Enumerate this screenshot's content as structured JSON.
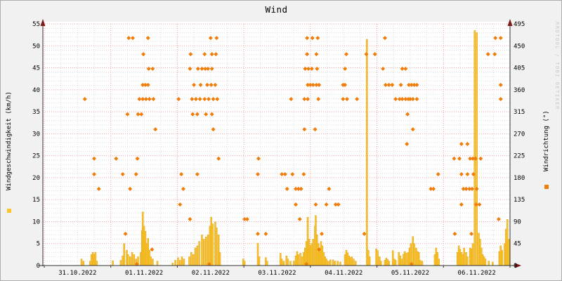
{
  "title": "Wind",
  "watermark": "RRDTOOL / TOBI OETIKER",
  "colors": {
    "background": "#F1F1F1",
    "plot_background": "#FFFFFF",
    "grid_major": "#F2A2A2",
    "grid_minor": "#DCDCDC",
    "axis": "#333333",
    "arrow": "#7F1A1A",
    "bar_fill": "#FBC52D",
    "bar_stroke": "#DE9F12",
    "scatter": "#F07D0A",
    "text": "#000000",
    "watermark_color": "#C9C9C9"
  },
  "axes": {
    "left": {
      "label": "Windgeschwindigkeit (km/h)",
      "min": 0,
      "max": 55,
      "major_step": 5,
      "minor_step": 1,
      "ticks": [
        0,
        5,
        10,
        15,
        20,
        25,
        30,
        35,
        40,
        45,
        50,
        55
      ]
    },
    "right": {
      "label": "Windrichtung (°)",
      "min": 0,
      "max": 495,
      "major_step": 45,
      "ticks": [
        0,
        45,
        90,
        135,
        180,
        225,
        270,
        315,
        360,
        405,
        450,
        495
      ]
    },
    "x": {
      "labels": [
        "31.10.2022",
        "01.11.2022",
        "02.11.2022",
        "03.11.2022",
        "04.11.2022",
        "05.11.2022",
        "06.11.2022"
      ],
      "days_shown": 7,
      "major_grid": "midnight",
      "minor_grid_hours": 6
    }
  },
  "legend": {
    "speed_label": "Windgeschwindigkeit (km/h)",
    "direction_label": "Windrichtung (°)"
  },
  "chart_data": {
    "type": "mixed",
    "title": "Wind",
    "x_unit": "days since 31.10.2022 00:00",
    "x_range": [
      0,
      7
    ],
    "left_ylim": [
      0,
      55
    ],
    "right_ylim": [
      0,
      495
    ],
    "grid": true,
    "series": [
      {
        "name": "Windgeschwindigkeit (km/h)",
        "type": "bar",
        "axis": "left",
        "color": "#FBC52D",
        "points": [
          [
            0.56,
            1.5
          ],
          [
            0.59,
            1
          ],
          [
            0.69,
            1
          ],
          [
            0.71,
            2.5
          ],
          [
            0.73,
            3
          ],
          [
            0.75,
            2.5
          ],
          [
            0.77,
            3
          ],
          [
            0.79,
            1
          ],
          [
            1.03,
            1.1
          ],
          [
            1.15,
            1.2
          ],
          [
            1.18,
            2.2
          ],
          [
            1.2,
            5
          ],
          [
            1.24,
            3.5
          ],
          [
            1.26,
            2.5
          ],
          [
            1.29,
            2
          ],
          [
            1.32,
            3
          ],
          [
            1.35,
            2.5
          ],
          [
            1.38,
            1.5
          ],
          [
            1.41,
            2
          ],
          [
            1.45,
            3
          ],
          [
            1.47,
            8
          ],
          [
            1.48,
            12.2
          ],
          [
            1.5,
            9
          ],
          [
            1.52,
            7.8
          ],
          [
            1.54,
            5
          ],
          [
            1.56,
            6.2
          ],
          [
            1.58,
            3.5
          ],
          [
            1.6,
            2
          ],
          [
            1.63,
            1.5
          ],
          [
            1.7,
            1
          ],
          [
            1.93,
            0.6
          ],
          [
            1.97,
            1.2
          ],
          [
            2.01,
            1.8
          ],
          [
            2.04,
            1.2
          ],
          [
            2.07,
            2
          ],
          [
            2.1,
            1.5
          ],
          [
            2.18,
            2
          ],
          [
            2.21,
            3
          ],
          [
            2.24,
            2.5
          ],
          [
            2.27,
            4
          ],
          [
            2.3,
            4.5
          ],
          [
            2.33,
            5.5
          ],
          [
            2.37,
            7
          ],
          [
            2.4,
            6
          ],
          [
            2.43,
            6.5
          ],
          [
            2.46,
            7
          ],
          [
            2.49,
            9
          ],
          [
            2.51,
            11
          ],
          [
            2.53,
            9.5
          ],
          [
            2.57,
            9.9
          ],
          [
            2.59,
            8.6
          ],
          [
            2.62,
            7
          ],
          [
            2.64,
            3
          ],
          [
            2.99,
            1.5
          ],
          [
            3.01,
            1
          ],
          [
            3.21,
            5.1
          ],
          [
            3.23,
            2
          ],
          [
            3.33,
            1.8
          ],
          [
            3.35,
            1
          ],
          [
            3.55,
            2.8
          ],
          [
            3.57,
            1.5
          ],
          [
            3.6,
            1
          ],
          [
            3.64,
            2.2
          ],
          [
            3.66,
            1.5
          ],
          [
            3.7,
            1
          ],
          [
            3.75,
            1
          ],
          [
            3.78,
            2.2
          ],
          [
            3.8,
            3.2
          ],
          [
            3.82,
            2.5
          ],
          [
            3.85,
            2.8
          ],
          [
            3.88,
            2
          ],
          [
            3.9,
            3
          ],
          [
            3.92,
            4
          ],
          [
            3.94,
            5.5
          ],
          [
            3.96,
            11
          ],
          [
            3.98,
            6
          ],
          [
            4.0,
            4.5
          ],
          [
            4.02,
            5
          ],
          [
            4.04,
            6
          ],
          [
            4.07,
            9
          ],
          [
            4.08,
            11.4
          ],
          [
            4.1,
            7
          ],
          [
            4.12,
            5
          ],
          [
            4.14,
            4
          ],
          [
            4.16,
            5.5
          ],
          [
            4.18,
            4.5
          ],
          [
            4.2,
            3
          ],
          [
            4.22,
            2
          ],
          [
            4.24,
            1.5
          ],
          [
            4.27,
            1
          ],
          [
            4.3,
            1.3
          ],
          [
            4.34,
            1.3
          ],
          [
            4.37,
            1
          ],
          [
            4.41,
            1
          ],
          [
            4.45,
            0.8
          ],
          [
            4.52,
            2.5
          ],
          [
            4.54,
            3.5
          ],
          [
            4.56,
            2.9
          ],
          [
            4.58,
            2.2
          ],
          [
            4.6,
            1.8
          ],
          [
            4.62,
            2
          ],
          [
            4.65,
            1.5
          ],
          [
            4.68,
            1
          ],
          [
            4.85,
            51.5
          ],
          [
            4.87,
            3.5
          ],
          [
            4.89,
            2
          ],
          [
            4.99,
            3.8
          ],
          [
            5.01,
            3.4
          ],
          [
            5.04,
            2
          ],
          [
            5.06,
            1
          ],
          [
            5.12,
            1.2
          ],
          [
            5.14,
            1.7
          ],
          [
            5.16,
            1.4
          ],
          [
            5.18,
            1
          ],
          [
            5.24,
            3.4
          ],
          [
            5.26,
            1.5
          ],
          [
            5.28,
            1.2
          ],
          [
            5.33,
            3
          ],
          [
            5.35,
            2.2
          ],
          [
            5.37,
            1.5
          ],
          [
            5.4,
            2.6
          ],
          [
            5.42,
            3.2
          ],
          [
            5.44,
            2.8
          ],
          [
            5.47,
            3
          ],
          [
            5.49,
            4
          ],
          [
            5.51,
            5
          ],
          [
            5.54,
            6.6
          ],
          [
            5.56,
            5
          ],
          [
            5.59,
            4
          ],
          [
            5.61,
            3.2
          ],
          [
            5.63,
            3
          ],
          [
            5.65,
            1.2
          ],
          [
            5.68,
            1
          ],
          [
            5.87,
            2.5
          ],
          [
            5.89,
            4
          ],
          [
            5.91,
            3
          ],
          [
            5.93,
            1.5
          ],
          [
            6.21,
            3
          ],
          [
            6.23,
            4.5
          ],
          [
            6.25,
            3.7
          ],
          [
            6.27,
            3
          ],
          [
            6.29,
            2.5
          ],
          [
            6.31,
            4
          ],
          [
            6.34,
            3
          ],
          [
            6.36,
            2
          ],
          [
            6.4,
            4
          ],
          [
            6.42,
            3.8
          ],
          [
            6.44,
            5
          ],
          [
            6.47,
            53.5
          ],
          [
            6.5,
            53
          ],
          [
            6.53,
            7.4
          ],
          [
            6.55,
            6
          ],
          [
            6.57,
            4
          ],
          [
            6.59,
            2.5
          ],
          [
            6.61,
            2
          ],
          [
            6.63,
            1.5
          ],
          [
            6.68,
            1
          ],
          [
            6.74,
            0.8
          ],
          [
            6.84,
            3.2
          ],
          [
            6.86,
            4.5
          ],
          [
            6.88,
            3.5
          ],
          [
            6.92,
            5
          ],
          [
            6.94,
            8.3
          ],
          [
            6.96,
            10.5
          ],
          [
            6.98,
            6
          ]
        ]
      },
      {
        "name": "Windrichtung (°)",
        "type": "scatter",
        "axis": "right",
        "color": "#F07D0A",
        "rows": [
          {
            "deg": 466,
            "t": [
              1.27,
              1.33,
              1.56,
              2.5,
              2.59,
              3.95,
              4.03,
              4.11,
              5.12,
              6.78,
              6.86
            ]
          },
          {
            "deg": 433,
            "t": [
              1.49,
              2.2,
              2.41,
              2.52,
              2.58,
              3.95,
              4.09,
              4.54,
              4.84,
              4.97,
              6.67,
              6.77
            ]
          },
          {
            "deg": 403,
            "t": [
              1.57,
              1.63,
              2.19,
              2.31,
              2.37,
              2.42,
              2.46,
              2.52,
              3.92,
              3.97,
              4.02,
              4.1,
              4.52,
              5.09,
              5.38,
              5.43
            ]
          },
          {
            "deg": 370,
            "t": [
              1.48,
              1.52,
              1.56,
              2.25,
              2.35,
              2.45,
              2.51,
              2.57,
              3.96,
              4.0,
              4.04,
              4.09,
              4.13,
              4.49,
              4.52,
              5.13,
              5.18,
              5.23,
              5.36,
              5.48,
              5.52,
              5.56,
              5.6,
              6.86
            ]
          },
          {
            "deg": 341,
            "t": [
              0.61,
              1.43,
              1.48,
              1.53,
              1.58,
              1.64,
              2.02,
              2.22,
              2.28,
              2.34,
              2.41,
              2.47,
              2.54,
              2.6,
              3.71,
              3.91,
              3.96,
              4.12,
              4.49,
              4.55,
              4.7,
              5.28,
              5.34,
              5.38,
              5.43,
              5.47,
              5.5,
              5.54,
              5.6,
              6.86
            ]
          },
          {
            "deg": 310,
            "t": [
              1.25,
              1.41,
              1.46,
              2.23,
              2.3,
              2.43,
              2.52,
              5.46
            ]
          },
          {
            "deg": 279,
            "t": [
              1.67,
              2.54,
              3.91,
              4.07,
              5.54
            ]
          },
          {
            "deg": 249,
            "t": [
              5.45,
              6.27,
              6.36
            ]
          },
          {
            "deg": 219,
            "t": [
              0.75,
              1.08,
              1.4,
              2.62,
              3.22,
              6.16,
              6.24,
              6.4,
              6.44,
              6.48,
              6.56
            ]
          },
          {
            "deg": 187,
            "t": [
              0.75,
              1.18,
              1.38,
              2.06,
              2.3,
              3.21,
              3.57,
              3.62,
              3.73,
              3.9,
              5.92,
              6.27,
              6.36,
              6.45
            ]
          },
          {
            "deg": 157,
            "t": [
              0.82,
              1.29,
              2.09,
              3.65,
              3.78,
              3.82,
              3.86,
              4.28,
              5.81,
              5.85,
              6.3,
              6.34,
              6.39,
              6.43,
              6.5
            ]
          },
          {
            "deg": 125,
            "t": [
              2.04,
              3.78,
              4.08,
              4.24,
              4.38,
              4.42,
              6.27,
              6.49,
              6.54
            ]
          },
          {
            "deg": 95,
            "t": [
              2.19,
              3.01,
              3.05,
              3.84,
              6.83
            ]
          },
          {
            "deg": 65,
            "t": [
              1.22,
              3.21,
              3.33,
              4.17,
              4.81,
              6.17,
              6.42
            ]
          },
          {
            "deg": 33,
            "t": [
              1.62,
              4.13
            ]
          },
          {
            "deg": 3,
            "t": [
              1.39,
              2.48,
              3.94,
              5.52
            ]
          }
        ]
      }
    ]
  }
}
